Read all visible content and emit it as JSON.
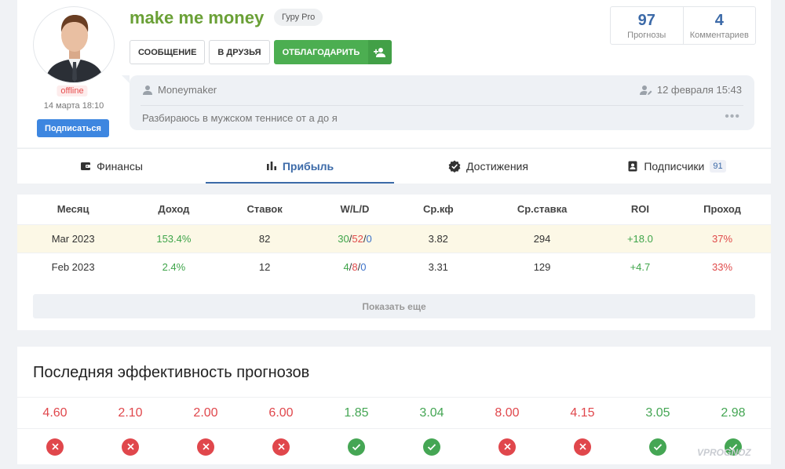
{
  "profile": {
    "username": "make me money",
    "badge": "Гуру Pro",
    "status": "offline",
    "last_seen": "14 марта 18:10",
    "subscribe_label": "Подписаться",
    "buttons": {
      "message": "СООБЩЕНИЕ",
      "friends": "В ДРУЗЬЯ",
      "thank": "ОТБЛАГОДАРИТЬ"
    },
    "stats": [
      {
        "value": "97",
        "label": "Прогнозы"
      },
      {
        "value": "4",
        "label": "Комментариев"
      }
    ],
    "bio": {
      "author": "Moneymaker",
      "date": "12 февраля 15:43",
      "text": "Разбираюсь в мужском теннисе от а до я",
      "more": "•••"
    }
  },
  "tabs": [
    {
      "label": "Финансы",
      "icon": "wallet-icon"
    },
    {
      "label": "Прибыль",
      "icon": "bar-chart-icon",
      "active": true
    },
    {
      "label": "Достижения",
      "icon": "verified-badge-icon"
    },
    {
      "label": "Подписчики",
      "icon": "contacts-icon",
      "count": "91"
    }
  ],
  "table": {
    "headers": [
      "Месяц",
      "Доход",
      "Ставок",
      "W/L/D",
      "Ср.кф",
      "Ср.ставка",
      "ROI",
      "Проход"
    ],
    "rows": [
      {
        "month": "Mar 2023",
        "income": "153.4%",
        "bets": "82",
        "w": "30",
        "l": "52",
        "d": "0",
        "avg_odds": "3.82",
        "avg_stake": "294",
        "roi": "+18.0",
        "pass": "37%"
      },
      {
        "month": "Feb 2023",
        "income": "2.4%",
        "bets": "12",
        "w": "4",
        "l": "8",
        "d": "0",
        "avg_odds": "3.31",
        "avg_stake": "129",
        "roi": "+4.7",
        "pass": "33%"
      }
    ],
    "show_more": "Показать еще"
  },
  "performance": {
    "title": "Последняя эффективность прогнозов",
    "items": [
      {
        "odds": "4.60",
        "result": "lose"
      },
      {
        "odds": "2.10",
        "result": "lose"
      },
      {
        "odds": "2.00",
        "result": "lose"
      },
      {
        "odds": "6.00",
        "result": "lose"
      },
      {
        "odds": "1.85",
        "result": "win"
      },
      {
        "odds": "3.04",
        "result": "win"
      },
      {
        "odds": "8.00",
        "result": "lose"
      },
      {
        "odds": "4.15",
        "result": "lose"
      },
      {
        "odds": "3.05",
        "result": "win"
      },
      {
        "odds": "2.98",
        "result": "win"
      }
    ],
    "colors": {
      "win": "#45a654",
      "lose": "#e0474c"
    }
  },
  "watermark": "VPROGNOZ"
}
